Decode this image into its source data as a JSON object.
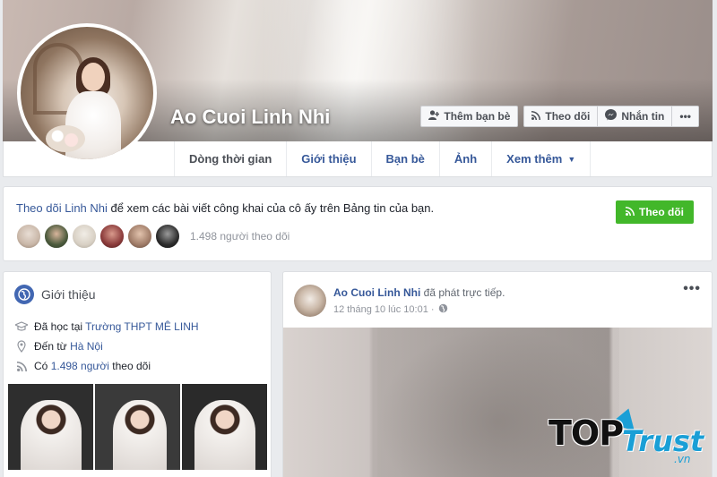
{
  "profile": {
    "name": "Ao Cuoi Linh Nhi"
  },
  "cover_actions": {
    "add_friend": "Thêm bạn bè",
    "follow": "Theo dõi",
    "message": "Nhắn tin",
    "more": "•••"
  },
  "tabs": [
    {
      "label": "Dòng thời gian"
    },
    {
      "label": "Giới thiệu"
    },
    {
      "label": "Bạn bè"
    },
    {
      "label": "Ảnh"
    },
    {
      "label": "Xem thêm"
    }
  ],
  "follow_box": {
    "link_text": "Theo dõi Linh Nhi",
    "rest_text": " để xem các bài viết công khai của cô ấy trên Bảng tin của bạn.",
    "button": "Theo dõi",
    "followers_count": "1.498 người theo dõi",
    "follower_colors": [
      "#c9b7a8",
      "#4b5a3c",
      "#d8d0c4",
      "#8b3b3b",
      "#a07c68",
      "#2c2c2c"
    ]
  },
  "intro": {
    "title": "Giới thiệu",
    "studied_prefix": "Đã học tại ",
    "studied_school": "Trường THPT MÊ LINH",
    "from_prefix": "Đến từ ",
    "from_place": "Hà Nội",
    "followers_prefix": "Có ",
    "followers_link": "1.498 người",
    "followers_suffix": " theo dõi"
  },
  "post": {
    "author": "Ao Cuoi Linh Nhi",
    "action": " đã phát trực tiếp.",
    "time": "12 tháng 10 lúc 10:01 ·",
    "more": "•••"
  },
  "watermark": {
    "top": "TOP",
    "trust": "Trust",
    "vn": ".vn"
  },
  "colors": {
    "link": "#365899",
    "follow_green": "#42b72a",
    "fb_blue": "#4267b2"
  }
}
